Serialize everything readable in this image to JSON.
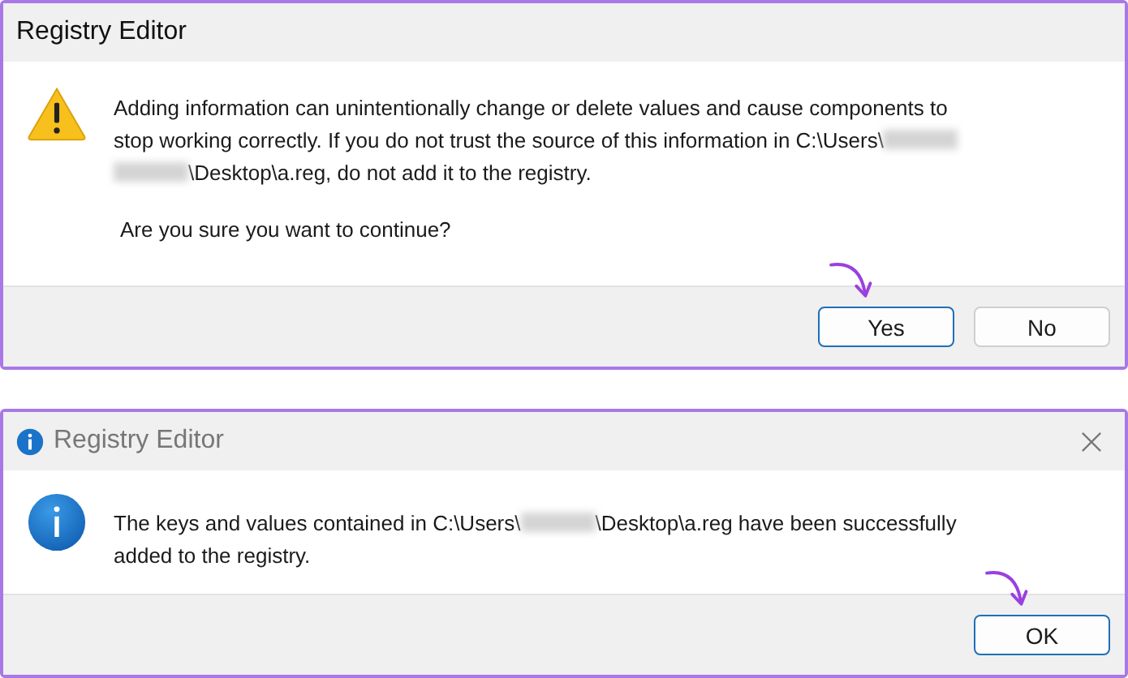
{
  "dialogs": [
    {
      "title": "Registry Editor",
      "active": true,
      "title_icon": false,
      "close_button": false,
      "kind": "warning",
      "message_lines": [
        [
          {
            "kind": "text",
            "text": "Adding information can unintentionally change or delete values and cause components to"
          }
        ],
        [
          {
            "kind": "text",
            "text": "stop working correctly. If you do not trust the source of this information in C:\\Users\\"
          },
          {
            "kind": "redacted"
          }
        ],
        [
          {
            "kind": "redacted"
          },
          {
            "kind": "text",
            "text": "\\Desktop\\a.reg, do not add it to the registry."
          }
        ]
      ],
      "question": "Are you sure you want to continue?",
      "buttons": [
        {
          "label": "Yes",
          "selected": true,
          "annotated": true
        },
        {
          "label": "No",
          "selected": false,
          "annotated": false
        }
      ]
    },
    {
      "title": "Registry Editor",
      "active": false,
      "title_icon": true,
      "close_button": true,
      "kind": "info",
      "message_lines": [
        [
          {
            "kind": "text",
            "text": "The keys and values contained in C:\\Users\\"
          },
          {
            "kind": "redacted"
          },
          {
            "kind": "text",
            "text": "\\Desktop\\a.reg have been successfully"
          }
        ],
        [
          {
            "kind": "text",
            "text": "added to the registry."
          }
        ]
      ],
      "buttons": [
        {
          "label": "OK",
          "selected": true,
          "annotated": true
        }
      ]
    }
  ]
}
